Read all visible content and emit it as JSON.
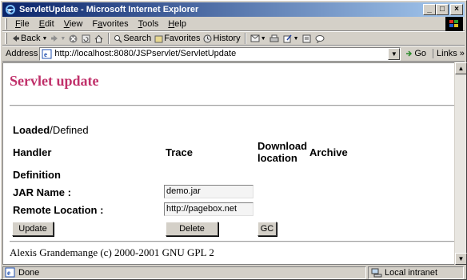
{
  "window": {
    "title": "ServletUpdate - Microsoft Internet Explorer",
    "minimize": "_",
    "maximize": "□",
    "close": "×"
  },
  "menu": {
    "items": [
      {
        "label": "File",
        "ul": "F",
        "rest": "ile"
      },
      {
        "label": "Edit",
        "ul": "E",
        "rest": "dit"
      },
      {
        "label": "View",
        "ul": "V",
        "rest": "iew"
      },
      {
        "label": "Favorites",
        "ul": "a",
        "pre": "F",
        "rest": "vorites"
      },
      {
        "label": "Tools",
        "ul": "T",
        "rest": "ools"
      },
      {
        "label": "Help",
        "ul": "H",
        "rest": "elp"
      }
    ]
  },
  "toolbar": {
    "back": "Back",
    "search": "Search",
    "favorites": "Favorites",
    "history": "History"
  },
  "address": {
    "label": "Address",
    "url": "http://localhost:8080/JSPservlet/ServletUpdate",
    "go": "Go",
    "links": "Links"
  },
  "page": {
    "title": "Servlet update",
    "loaded_bold": "Loaded",
    "loaded_rest": "/Defined",
    "headers": {
      "handler": "Handler",
      "trace": "Trace",
      "download_1": "Download",
      "download_2": "location",
      "archive": "Archive"
    },
    "definition": "Definition",
    "jar_label": "JAR Name :",
    "jar_value": "demo.jar",
    "remote_label": "Remote Location :",
    "remote_value": "http://pagebox.net",
    "buttons": {
      "update": "Update",
      "delete": "Delete",
      "gc": "GC"
    },
    "footer": "Alexis Grandemange (c) 2000-2001 GNU GPL 2"
  },
  "status": {
    "text": "Done",
    "zone": "Local intranet"
  }
}
